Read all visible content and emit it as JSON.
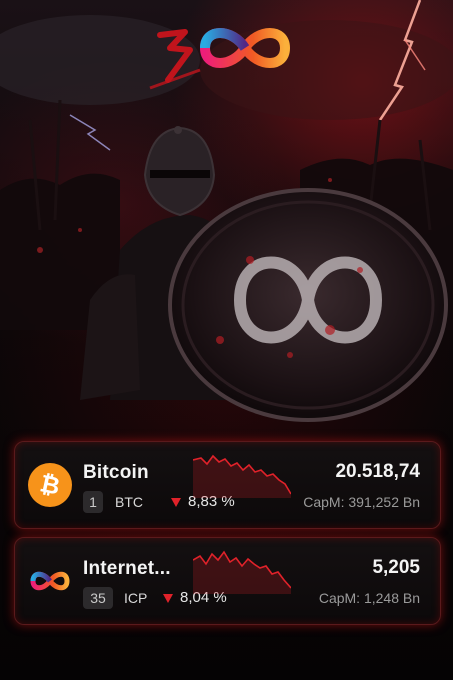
{
  "colors": {
    "accent_red": "#e0222a",
    "bitcoin_orange": "#f7931a",
    "icp_gradient": [
      "#29abe2",
      "#522785",
      "#ed1e79",
      "#f15a24",
      "#fbb03b"
    ]
  },
  "header_logo": {
    "icon": "icp-300-logo-icon"
  },
  "coins": [
    {
      "name": "Bitcoin",
      "rank": "1",
      "ticker": "BTC",
      "change": "8,83 %",
      "trend": "down",
      "price": "20.518,74",
      "market_cap": "CapM: 391,252 Bn",
      "icon": "bitcoin-icon"
    },
    {
      "name": "Internet...",
      "rank": "35",
      "ticker": "ICP",
      "change": "8,04 %",
      "trend": "down",
      "price": "5,205",
      "market_cap": "CapM: 1,248 Bn",
      "icon": "internet-computer-icon"
    }
  ]
}
